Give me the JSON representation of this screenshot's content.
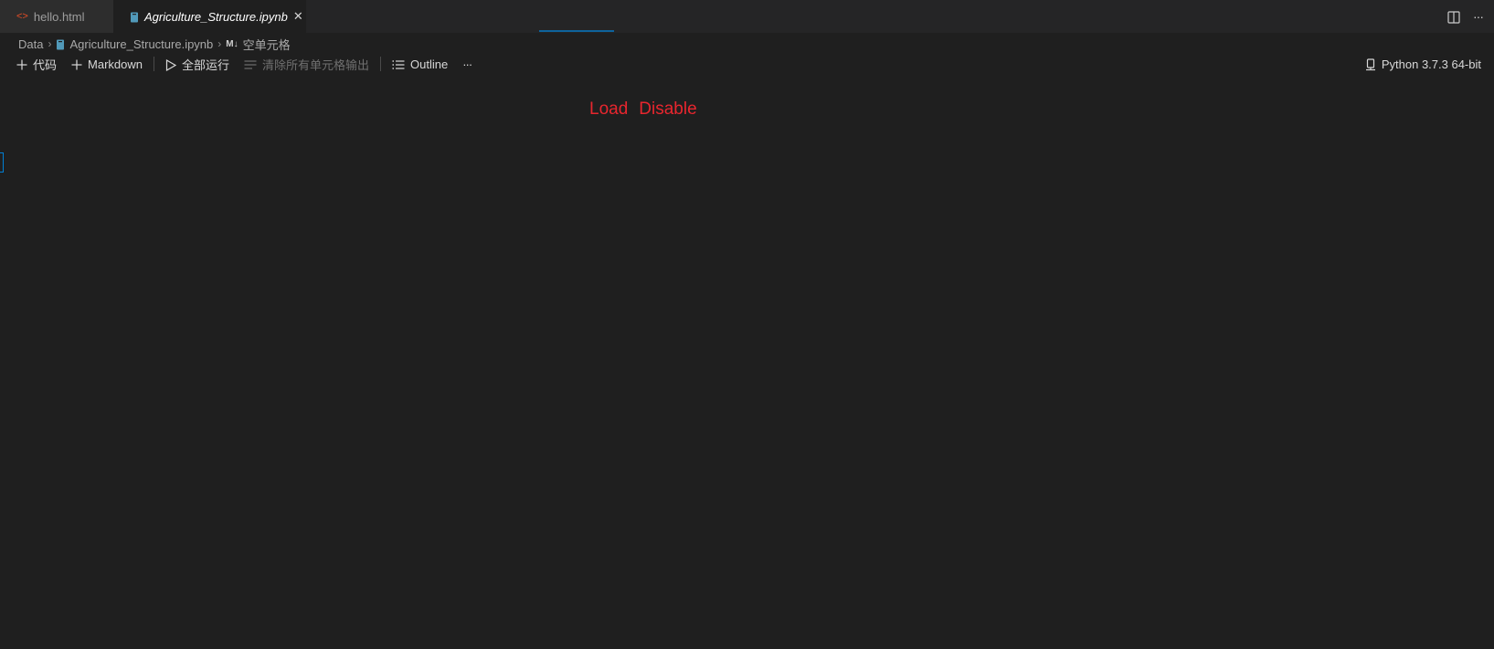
{
  "tabs": [
    {
      "label": "hello.html",
      "icon": "html-code-icon",
      "icon_color": "#e44d26",
      "active": false
    },
    {
      "label": "Agriculture_Structure.ipynb",
      "icon": "notebook-icon",
      "icon_color": "#519aba",
      "active": true
    }
  ],
  "tab_close_glyph": "✕",
  "breadcrumb": {
    "folder": "Data",
    "file": "Agriculture_Structure.ipynb",
    "md_badge": "M↓",
    "cell": "空单元格"
  },
  "toolbar": {
    "add_code_label": "代码",
    "add_markdown_label": "Markdown",
    "run_all_label": "全部运行",
    "clear_outputs_label": "清除所有单元格输出",
    "outline_label": "Outline",
    "more_glyph": "···",
    "kernel_label": "Python 3.7.3 64-bit"
  },
  "status": {
    "load_label": "Load",
    "disable_label": "Disable",
    "color": "#e8262e"
  },
  "colors": {
    "background": "#1f1f1f",
    "tabbar": "#252526",
    "accent": "#007fd4"
  }
}
